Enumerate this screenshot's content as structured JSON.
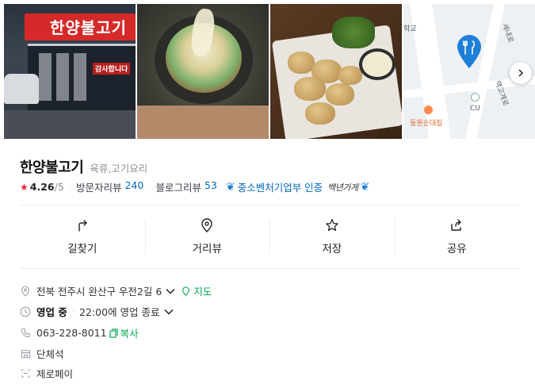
{
  "photos": {
    "store_sign_text": "한양불고기",
    "store_thanks": "감사합니다",
    "map": {
      "labels": [
        "학교",
        "세내로",
        "맥고개로",
        "동원순대집",
        "CU"
      ]
    }
  },
  "place": {
    "name": "한양불고기",
    "category": "육류,고기요리"
  },
  "meta": {
    "rating": "4.26",
    "rating_max": "/5",
    "visitor_review_label": "방문자리뷰",
    "visitor_review_count": "240",
    "blog_review_label": "블로그리뷰",
    "blog_review_count": "53",
    "certification": "중소벤처기업부 인증",
    "certification_signature": "백년가게"
  },
  "actions": [
    {
      "label": "길찾기",
      "icon": "directions-icon"
    },
    {
      "label": "거리뷰",
      "icon": "streetview-icon"
    },
    {
      "label": "저장",
      "icon": "star-icon"
    },
    {
      "label": "공유",
      "icon": "share-icon"
    }
  ],
  "info": {
    "address": "전북 전주시 완산구 우전2길 6",
    "map_link": "지도",
    "status": "영업 중",
    "hours": "22:00에 영업 종료",
    "phone": "063-228-8011",
    "copy_label": "복사",
    "group_seating": "단체석",
    "payment": "제로페이"
  },
  "colors": {
    "accent_blue": "#0068c3",
    "green": "#03a94d",
    "rating_red": "#e8253a"
  }
}
